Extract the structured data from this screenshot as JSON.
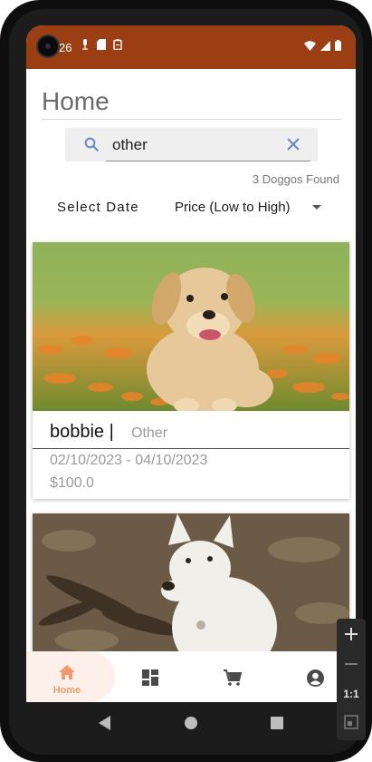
{
  "status_bar": {
    "time": "26",
    "color": "#9b3e14"
  },
  "page": {
    "title": "Home"
  },
  "search": {
    "value": "other",
    "icon": "search-icon",
    "clear_icon": "close-icon"
  },
  "results": {
    "count_text": "3 Doggos Found"
  },
  "filters": {
    "select_date_label": "Select Date",
    "sort_value": "Price (Low to High)"
  },
  "listings": [
    {
      "name": "bobbie |",
      "breed": "Other",
      "date_range": "02/10/2023 - 04/10/2023",
      "price": "$100.0",
      "image": "golden-puppy-photo"
    },
    {
      "image": "white-shepherd-photo"
    }
  ],
  "bottom_nav": {
    "items": [
      {
        "label": "Home",
        "icon": "home-icon",
        "active": true
      },
      {
        "icon": "dashboard-icon"
      },
      {
        "icon": "cart-icon"
      },
      {
        "icon": "account-icon"
      }
    ],
    "accent": "#f09a6c"
  },
  "emulator_controls": {
    "ratio_label": "1:1"
  }
}
